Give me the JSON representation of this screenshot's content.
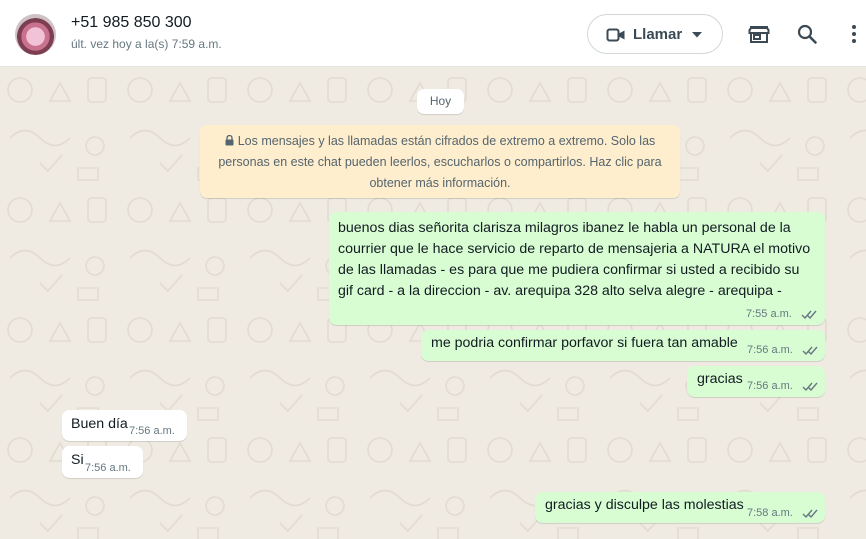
{
  "header": {
    "contact_name": "+51 985 850 300",
    "status": "últ. vez hoy a la(s) 7:59 a.m.",
    "call_label": "Llamar",
    "icons": [
      "video-camera-icon",
      "chevron-down-icon",
      "store-icon",
      "search-icon",
      "more-vert-icon"
    ]
  },
  "chat": {
    "day_label": "Hoy",
    "system_note": "Los mensajes y las llamadas están cifrados de extremo a extremo. Solo las personas en este chat pueden leerlos, escucharlos o compartirlos. Haz clic para obtener más información.",
    "messages": [
      {
        "direction": "out",
        "text": "buenos dias señorita clarisza milagros ibanez le habla un personal de la courrier que le hace servicio de reparto de mensajeria a NATURA el motivo de las llamadas - es para que me pudiera confirmar si usted a recibido su gif card - a la direccion - av. arequipa 328 alto selva alegre - arequipa -",
        "time": "7:55 a.m.",
        "status": "read"
      },
      {
        "direction": "out",
        "text": "me podria confirmar porfavor si fuera tan amable",
        "time": "7:56 a.m.",
        "status": "read"
      },
      {
        "direction": "out",
        "text": "gracias",
        "time": "7:56 a.m.",
        "status": "read"
      },
      {
        "direction": "in",
        "text": "Buen día",
        "time": "7:56 a.m."
      },
      {
        "direction": "in",
        "text": "Si",
        "time": "7:56 a.m."
      },
      {
        "direction": "out",
        "text": "gracias y disculpe las molestias",
        "time": "7:58 a.m.",
        "status": "read"
      }
    ]
  },
  "colors": {
    "chat_background": "#efeae2",
    "outgoing_bubble": "#d9fdd3",
    "incoming_bubble": "#ffffff",
    "system_note": "#ffeecd",
    "read_ticks": "#667781"
  }
}
